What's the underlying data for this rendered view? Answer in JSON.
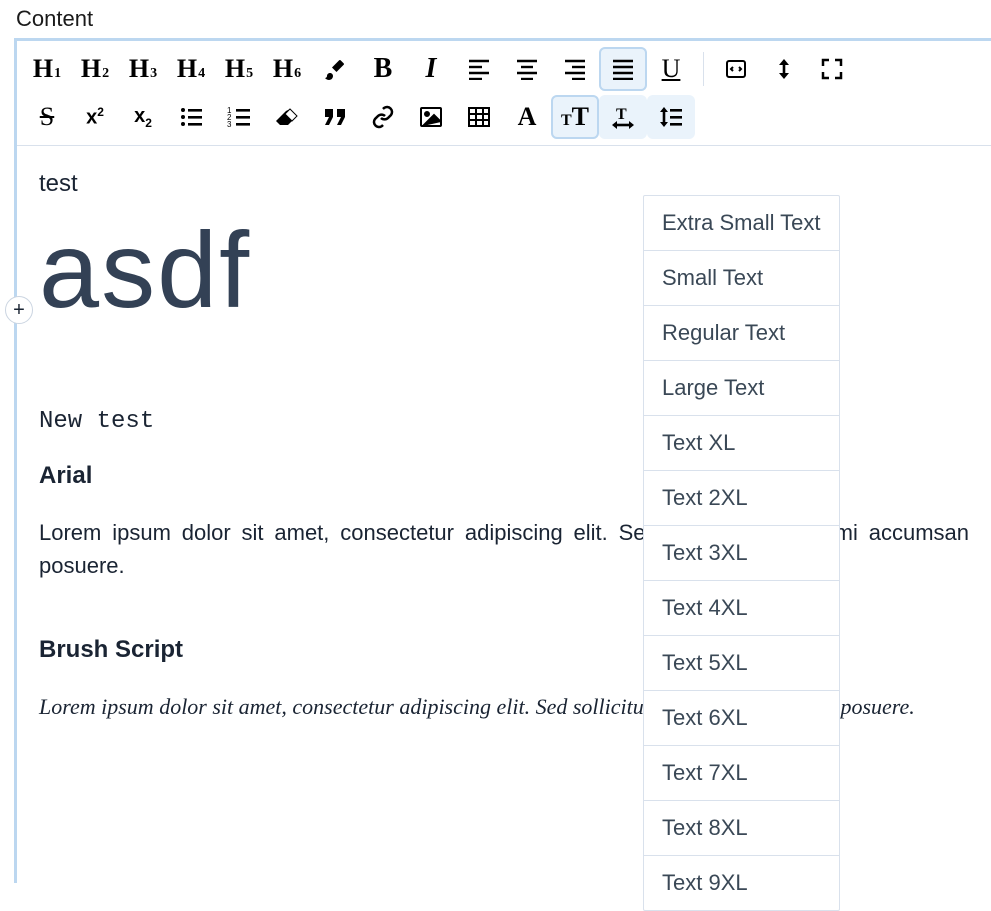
{
  "page_label": "Content",
  "plus_glyph": "+",
  "toolbar": {
    "h1": "1",
    "h2": "2",
    "h3": "3",
    "h4": "4",
    "h5": "5",
    "h6": "6"
  },
  "content": {
    "line1": "test",
    "big_heading": "asdf",
    "code_line": "New test",
    "arial_heading": "Arial",
    "arial_paragraph": "Lorem ipsum dolor sit amet, consectetur adipiscing elit. Sed sollicitudin eget mi accumsan posuere.",
    "brush_heading": "Brush Script",
    "brush_paragraph": "Lorem ipsum dolor sit amet, consectetur adipiscing elit. Sed sollicitudin eget mi accumsan posuere."
  },
  "dropdown": {
    "items": [
      "Extra Small Text",
      "Small Text",
      "Regular Text",
      "Large Text",
      "Text XL",
      "Text 2XL",
      "Text 3XL",
      "Text 4XL",
      "Text 5XL",
      "Text 6XL",
      "Text 7XL",
      "Text 8XL",
      "Text 9XL"
    ]
  }
}
